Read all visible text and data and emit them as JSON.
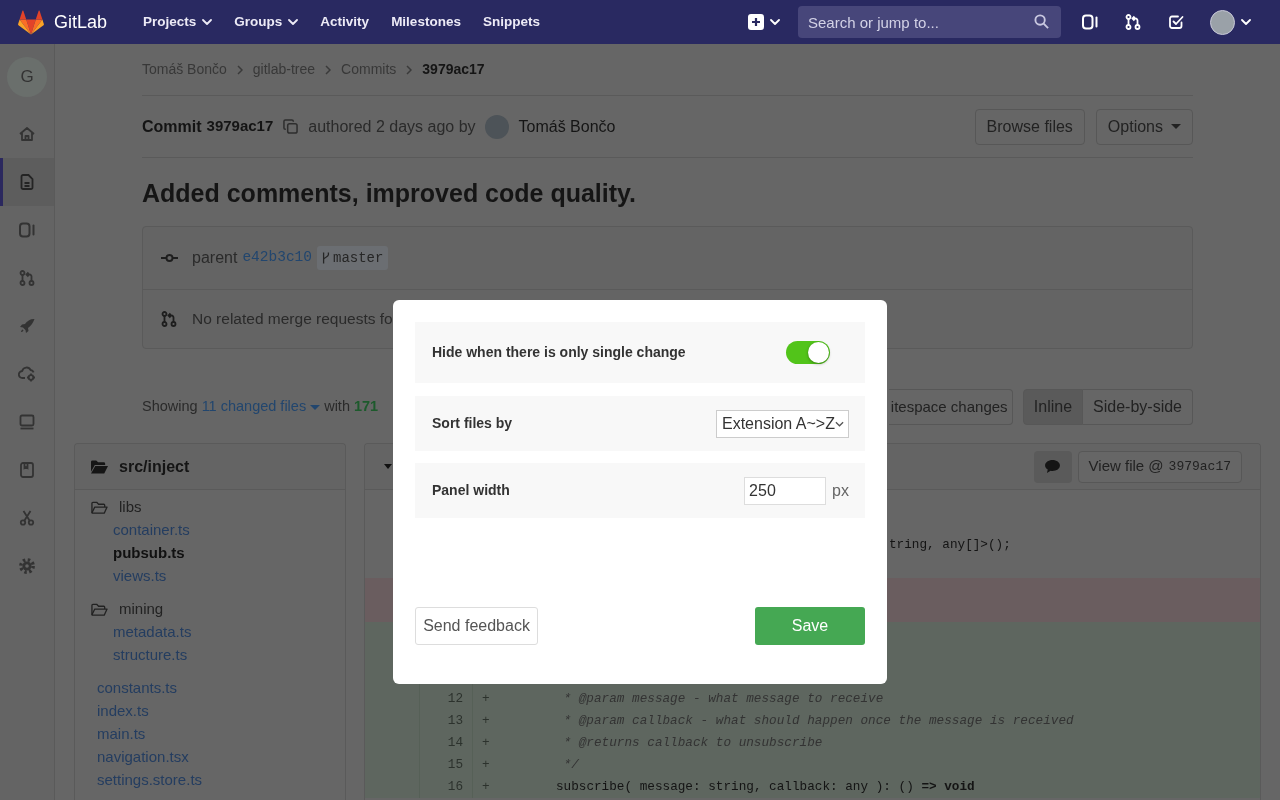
{
  "navbar": {
    "brand": "GitLab",
    "menu": [
      {
        "label": "Projects",
        "dropdown": true
      },
      {
        "label": "Groups",
        "dropdown": true
      },
      {
        "label": "Activity",
        "dropdown": false
      },
      {
        "label": "Milestones",
        "dropdown": false
      },
      {
        "label": "Snippets",
        "dropdown": false
      }
    ],
    "search": {
      "placeholder": "Search or jump to..."
    }
  },
  "sidebar": {
    "project_initial": "G",
    "items": [
      {
        "selected": false
      },
      {
        "selected": true
      },
      {
        "selected": false
      },
      {
        "selected": false
      },
      {
        "selected": false
      },
      {
        "selected": false
      },
      {
        "selected": false
      },
      {
        "selected": false
      },
      {
        "selected": false
      },
      {
        "selected": false
      }
    ]
  },
  "breadcrumbs": [
    {
      "label": "Tomáš Bončo",
      "current": false
    },
    {
      "label": "gitlab-tree",
      "current": false
    },
    {
      "label": "Commits",
      "current": false
    },
    {
      "label": "3979ac17",
      "current": true
    }
  ],
  "commit": {
    "label": "Commit",
    "sha": "3979ac17",
    "authored": "authored 2 days ago by",
    "author": "Tomáš Bončo",
    "actions": [
      {
        "label": "Browse files",
        "dropdown": false
      },
      {
        "label": "Options",
        "dropdown": true
      }
    ],
    "title": "Added comments, improved code quality.",
    "parent_label": "parent",
    "parent_sha": "e42b3c10",
    "branch": "master",
    "merge_requests": "No related merge requests fo"
  },
  "diff_summary": {
    "showing": "Showing",
    "files": "11 changed files",
    "with": "with",
    "additions": "171",
    "whitespace_button": "itespace changes",
    "view_modes": [
      {
        "label": "Inline",
        "selected": true
      },
      {
        "label": "Side-by-side",
        "selected": false
      }
    ]
  },
  "file_tree": {
    "title": "src/inject",
    "items": [
      {
        "kind": "folder",
        "name": "libs",
        "selected": false,
        "expanded": true,
        "children": [
          {
            "kind": "file",
            "name": "container.ts",
            "selected": false
          },
          {
            "kind": "file",
            "name": "pubsub.ts",
            "selected": true
          },
          {
            "kind": "file",
            "name": "views.ts",
            "selected": false
          }
        ]
      },
      {
        "kind": "folder",
        "name": "mining",
        "selected": false,
        "expanded": true,
        "children": [
          {
            "kind": "file",
            "name": "metadata.ts",
            "selected": false
          },
          {
            "kind": "file",
            "name": "structure.ts",
            "selected": false
          }
        ]
      },
      {
        "kind": "file",
        "name": "constants.ts",
        "selected": false
      },
      {
        "kind": "file",
        "name": "index.ts",
        "selected": false
      },
      {
        "kind": "file",
        "name": "main.ts",
        "selected": false
      },
      {
        "kind": "file",
        "name": "navigation.tsx",
        "selected": false
      },
      {
        "kind": "file",
        "name": "settings.store.ts",
        "selected": false
      }
    ]
  },
  "diff": {
    "view_file": {
      "label": "View file @",
      "sha": "3979ac17"
    },
    "lines": [
      {
        "kind": "context"
      },
      {
        "kind": "context"
      },
      {
        "kind": "context",
        "text": "tring, any[]>();",
        "comment": false
      },
      {
        "kind": "context"
      },
      {
        "kind": "removed"
      },
      {
        "kind": "removed"
      },
      {
        "kind": "added"
      },
      {
        "kind": "added"
      },
      {
        "kind": "added"
      },
      {
        "kind": "added",
        "number": "12",
        "sign": "+",
        "text": "         * @param message - what message to receive",
        "comment": true
      },
      {
        "kind": "added",
        "number": "13",
        "sign": "+",
        "text": "         * @param callback - what should happen once the message is received",
        "comment": true
      },
      {
        "kind": "added",
        "number": "14",
        "sign": "+",
        "text": "         * @returns callback to unsubscribe",
        "comment": true
      },
      {
        "kind": "added",
        "number": "15",
        "sign": "+",
        "text": "         */",
        "comment": true
      },
      {
        "kind": "added",
        "number": "16",
        "sign": "+",
        "text": "        subscribe( message: string, callback: any ): () **=> void**",
        "comment": false
      }
    ]
  },
  "settings_dialog": {
    "rows": [
      {
        "kind": "toggle",
        "label": "Hide when there is only single change",
        "on": true
      },
      {
        "kind": "select",
        "label": "Sort files by",
        "value": "Extension A~>Z"
      },
      {
        "kind": "number",
        "label": "Panel width",
        "value": "250",
        "unit": "px"
      }
    ],
    "buttons": [
      {
        "kind": "secondary",
        "label": "Send feedback"
      },
      {
        "kind": "primary",
        "label": "Save"
      }
    ]
  }
}
